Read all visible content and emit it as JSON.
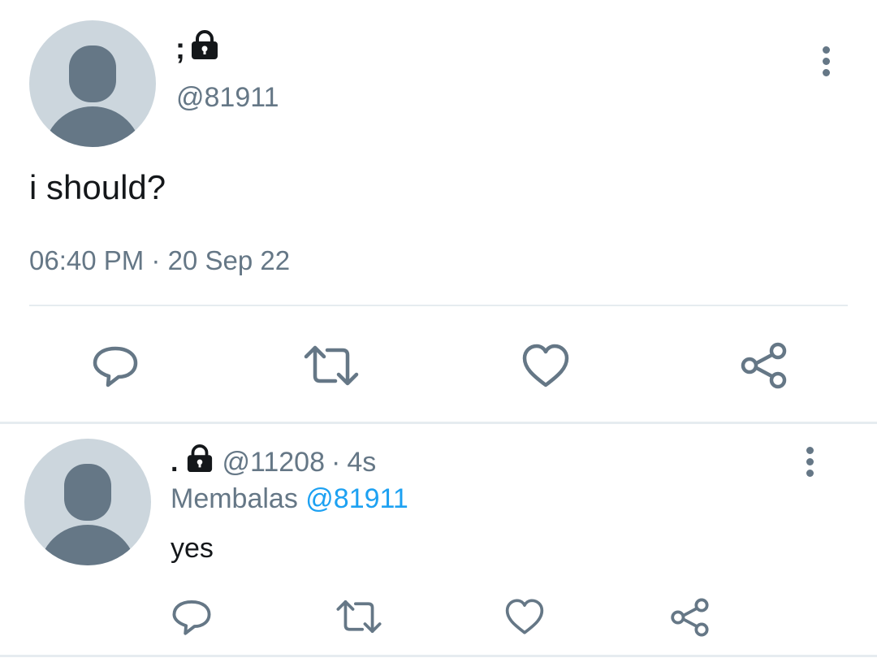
{
  "main_tweet": {
    "display_name": ";",
    "handle": "@81911",
    "text": "i should?",
    "timestamp": "06:40 PM · 20 Sep 22",
    "protected_icon": "lock-icon",
    "more_icon": "more-vertical-icon"
  },
  "actions_icons": [
    "reply-icon",
    "retweet-icon",
    "like-icon",
    "share-icon"
  ],
  "reply_tweet": {
    "display_name": ".",
    "handle": "@11208",
    "separator": "·",
    "time": "4s",
    "replying_prefix": "Membalas",
    "replying_to": "@81911",
    "text": "yes",
    "protected_icon": "lock-icon",
    "more_icon": "more-vertical-icon"
  },
  "colors": {
    "accent": "#1da1f2",
    "secondary_text": "#657786",
    "divider": "#e6ecf0",
    "avatar_bg": "#ccd6dd",
    "avatar_fg": "#657786"
  }
}
